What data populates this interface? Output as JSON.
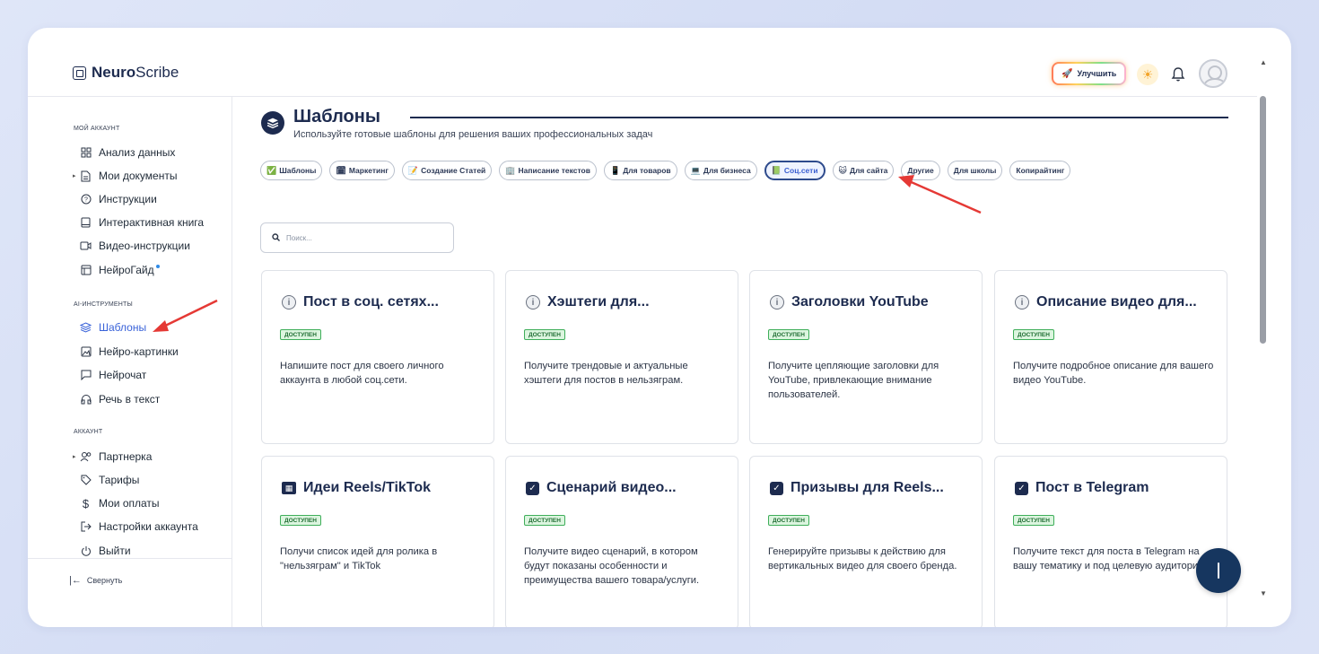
{
  "header": {
    "logo_bold": "Neuro",
    "logo_light": "Scribe",
    "upgrade_label": "Улучшить",
    "theme_icon": "sun-icon",
    "notifications_icon": "bell-icon",
    "avatar_icon": "user-avatar-icon"
  },
  "sidebar": {
    "sections": {
      "account": "МОЙ АККАУНТ",
      "ai_tools": "AI-ИНСТРУМЕНТЫ",
      "profile": "АККАУНТ"
    },
    "items": [
      {
        "label": "Анализ данных",
        "icon": "grid-icon"
      },
      {
        "label": "Мои документы",
        "icon": "document-icon"
      },
      {
        "label": "Инструкции",
        "icon": "help-circle-icon"
      },
      {
        "label": "Интерактивная книга",
        "icon": "book-icon"
      },
      {
        "label": "Видео-инструкции",
        "icon": "video-icon"
      },
      {
        "label": "НейроГайд",
        "icon": "guide-icon"
      },
      {
        "label": "Шаблоны",
        "icon": "layers-icon"
      },
      {
        "label": "Нейро-картинки",
        "icon": "image-icon"
      },
      {
        "label": "Нейрочат",
        "icon": "chat-icon"
      },
      {
        "label": "Речь в текст",
        "icon": "headphones-icon"
      },
      {
        "label": "Партнерка",
        "icon": "users-icon"
      },
      {
        "label": "Тарифы",
        "icon": "tag-icon"
      },
      {
        "label": "Мои оплаты",
        "icon": "dollar-icon"
      },
      {
        "label": "Настройки аккаунта",
        "icon": "settings-arrow-icon"
      },
      {
        "label": "Выйти",
        "icon": "power-icon"
      }
    ],
    "collapse_label": "Свернуть"
  },
  "main": {
    "title": "Шаблоны",
    "subtitle": "Используйте готовые шаблоны для решения ваших профессиональных задач",
    "chips": [
      {
        "label": "Шаблоны",
        "icon": "✅"
      },
      {
        "label": "Маркетинг",
        "icon": "🗓"
      },
      {
        "label": "Создание Статей",
        "icon": "📝"
      },
      {
        "label": "Написание текстов",
        "icon": "🏢"
      },
      {
        "label": "Для товаров",
        "icon": "📱"
      },
      {
        "label": "Для бизнеса",
        "icon": "💻"
      },
      {
        "label": "Соц.сети",
        "icon": "📗"
      },
      {
        "label": "Для сайта",
        "icon": "😺"
      },
      {
        "label": "Другие",
        "icon": ""
      },
      {
        "label": "Для школы",
        "icon": ""
      },
      {
        "label": "Копирайтинг",
        "icon": ""
      }
    ],
    "search_placeholder": "Поиск...",
    "cards": [
      {
        "title": "Пост в соц. сетях...",
        "badge": "ДОСТУПЕН",
        "desc": "Напишите пост для своего личного аккаунта в любой соц.сети.",
        "icon": "info-icon"
      },
      {
        "title": "Хэштеги для...",
        "badge": "ДОСТУПЕН",
        "desc": "Получите трендовые и актуальные хэштеги для постов в нельзяграм.",
        "icon": "info-icon"
      },
      {
        "title": "Заголовки YouTube",
        "badge": "ДОСТУПЕН",
        "desc": "Получите цепляющие заголовки для YouTube, привлекающие внимание пользователей.",
        "icon": "info-icon"
      },
      {
        "title": "Описание видео для...",
        "badge": "ДОСТУПЕН",
        "desc": "Получите подробное описание для вашего видео YouTube.",
        "icon": "info-icon"
      },
      {
        "title": "Идеи Reels/TikTok",
        "badge": "ДОСТУПЕН",
        "desc": "Получи список идей для ролика в \"нельзяграм\" и TikTok",
        "icon": "film-icon"
      },
      {
        "title": "Сценарий видео...",
        "badge": "ДОСТУПЕН",
        "desc": "Получите видео сценарий, в котором будут показаны особенности и преимущества вашего товара/услуги.",
        "icon": "checkbox-icon"
      },
      {
        "title": "Призывы для Reels...",
        "badge": "ДОСТУПЕН",
        "desc": "Генерируйте призывы к действию для вертикальных видео для своего бренда.",
        "icon": "checkbox-icon"
      },
      {
        "title": "Пост в Telegram",
        "badge": "ДОСТУПЕН",
        "desc": "Получите текст для поста в Telegram на вашу тематику и под целевую аудиторию.",
        "icon": "checkbox-icon"
      }
    ]
  },
  "colors": {
    "brand_dark": "#1d2b4f",
    "active_blue": "#3a63d9",
    "badge_green": "#3fae5a",
    "annotation_red": "#e53935"
  }
}
